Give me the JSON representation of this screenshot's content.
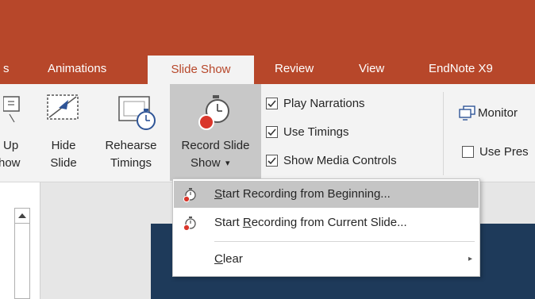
{
  "tabs": [
    {
      "label": "s",
      "active": false
    },
    {
      "label": "Animations",
      "active": false
    },
    {
      "label": "Slide Show",
      "active": true
    },
    {
      "label": "Review",
      "active": false
    },
    {
      "label": "View",
      "active": false
    },
    {
      "label": "EndNote X9",
      "active": false
    }
  ],
  "ribbon": {
    "setup_show": {
      "line1": "Up",
      "line2": "how"
    },
    "hide_slide": {
      "line1": "Hide",
      "line2": "Slide"
    },
    "rehearse_timings": {
      "line1": "Rehearse",
      "line2": "Timings"
    },
    "record_slide_show": {
      "line1": "Record Slide",
      "line2": "Show",
      "caret": "▾"
    },
    "checks": [
      {
        "label": "Play Narrations",
        "checked": true
      },
      {
        "label": "Use Timings",
        "checked": true
      },
      {
        "label": "Show Media Controls",
        "checked": true
      }
    ],
    "monitor": {
      "label": "Monitor"
    },
    "use_presenter": {
      "label": "Use Pres",
      "checked": false
    }
  },
  "menu": {
    "items": [
      {
        "pre": "",
        "key": "S",
        "post": "tart Recording from Beginning...",
        "icon": "record-timer-icon",
        "highlighted": true
      },
      {
        "pre": "Start ",
        "key": "R",
        "post": "ecording from Current Slide...",
        "icon": "record-timer-icon",
        "highlighted": false
      },
      {
        "pre": "",
        "key": "C",
        "post": "lear",
        "icon": "",
        "submenu": "▸"
      }
    ]
  },
  "colors": {
    "accent": "#b7472a",
    "ribbon_bg": "#f3f3f3",
    "highlight": "#c5c5c5",
    "record_red": "#d9362b"
  }
}
